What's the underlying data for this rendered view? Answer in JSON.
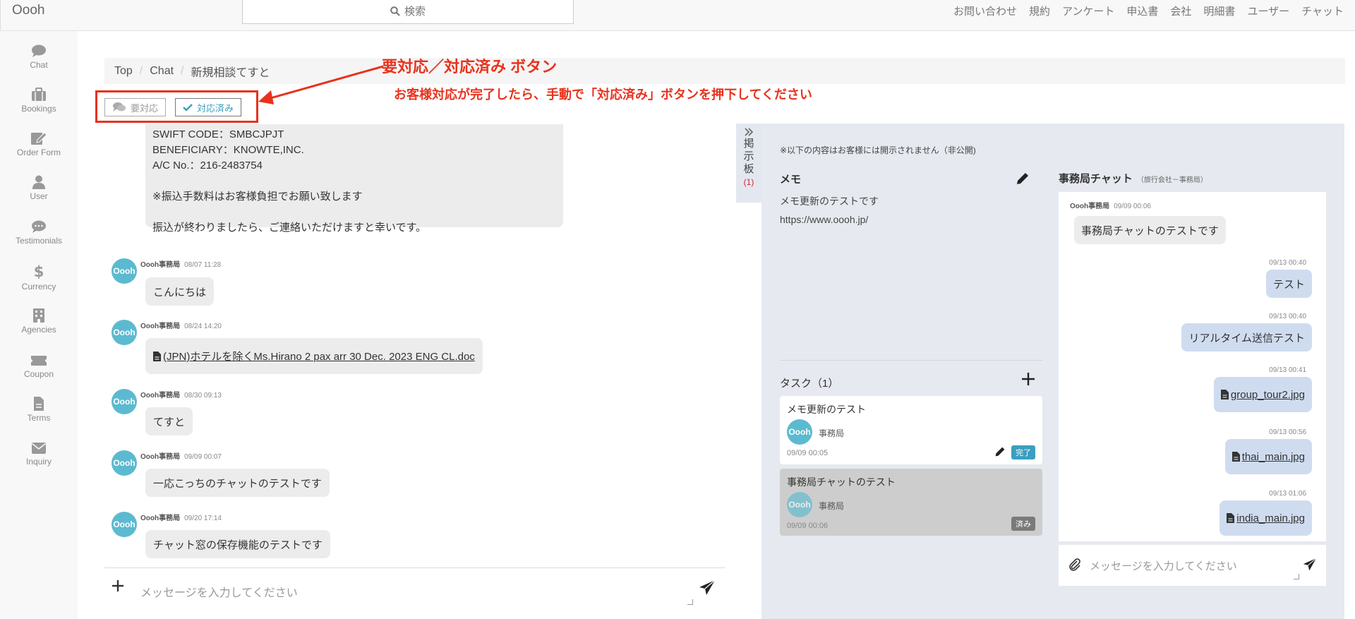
{
  "app": {
    "brand": "Oooh"
  },
  "search": {
    "label": "検索"
  },
  "nav": [
    "お問い合わせ",
    "規約",
    "アンケート",
    "申込書",
    "会社",
    "明細書",
    "ユーザー",
    "チャット"
  ],
  "sidebar": [
    {
      "label": "Chat",
      "icon": "chat-icon"
    },
    {
      "label": "Bookings",
      "icon": "briefcase-icon"
    },
    {
      "label": "Order Form",
      "icon": "order-form-icon"
    },
    {
      "label": "User",
      "icon": "user-icon"
    },
    {
      "label": "Testimonials",
      "icon": "testimonials-icon"
    },
    {
      "label": "Currency",
      "icon": "dollar-icon"
    },
    {
      "label": "Agencies",
      "icon": "building-icon"
    },
    {
      "label": "Coupon",
      "icon": "coupon-icon"
    },
    {
      "label": "Terms",
      "icon": "document-icon"
    },
    {
      "label": "Inquiry",
      "icon": "envelope-icon"
    }
  ],
  "breadcrumb": [
    "Top",
    "Chat",
    "新規相談てすと"
  ],
  "annotation": {
    "title": "要対応／対応済み ボタン",
    "description": "お客様対応が完了したら、手動で「対応済み」ボタンを押下してください"
  },
  "status_buttons": {
    "need": "要対応",
    "done": "対応済み"
  },
  "chat": {
    "top_message": [
      "SWIFT CODE：SMBCJPJT",
      "BENEFICIARY：KNOWTE,INC.",
      "A/C No.：216-2483754",
      "",
      "※振込手数料はお客様負担でお願い致します",
      "",
      "振込が終わりましたら、ご連絡いただけますと幸いです。"
    ],
    "avatar_label": "Oooh",
    "messages": [
      {
        "sender": "Oooh事務局",
        "time": "08/07 11:28",
        "text": "こんにちは",
        "file": false
      },
      {
        "sender": "Oooh事務局",
        "time": "08/24 14:20",
        "text": "(JPN)ホテルを除くMs.Hirano 2 pax arr 30 Dec. 2023 ENG CL.doc",
        "file": true
      },
      {
        "sender": "Oooh事務局",
        "time": "08/30 09:13",
        "text": "てすと",
        "file": false
      },
      {
        "sender": "Oooh事務局",
        "time": "09/09 00:07",
        "text": "一応こっちのチャットのテストです",
        "file": false
      },
      {
        "sender": "Oooh事務局",
        "time": "09/20 17:14",
        "text": "チャット窓の保存機能のテストです",
        "file": false
      }
    ],
    "input_placeholder": "メッセージを入力してください"
  },
  "board": {
    "label_chars": [
      "掲",
      "示",
      "板"
    ],
    "count": "(1)"
  },
  "panel": {
    "notice": "※以下の内容はお客様には開示されません（非公開)",
    "memo_title": "メモ",
    "memo_lines": [
      "メモ更新のテストです",
      "https://www.oooh.jp/"
    ],
    "task_title": "タスク（1）",
    "tasks": [
      {
        "title": "メモ更新のテスト",
        "assignee": "事務局",
        "date": "09/09 00:05",
        "badge": "完了",
        "done": false
      },
      {
        "title": "事務局チャットのテスト",
        "assignee": "事務局",
        "date": "09/09 00:06",
        "badge": "済み",
        "done": true
      }
    ],
    "office_chat": {
      "title": "事務局チャット",
      "subtitle": "（旅行会社－事務局）",
      "first": {
        "sender": "Oooh事務局",
        "time": "09/09 00:06",
        "text": "事務局チャットのテストです"
      },
      "messages": [
        {
          "time": "09/13 00:40",
          "text": "テスト",
          "file": false
        },
        {
          "time": "09/13 00:40",
          "text": "リアルタイム送信テスト",
          "file": false
        },
        {
          "time": "09/13 00:41",
          "text": "group_tour2.jpg",
          "file": true
        },
        {
          "time": "09/13 00:56",
          "text": "thai_main.jpg",
          "file": true
        },
        {
          "time": "09/13 01:06",
          "text": "india_main.jpg",
          "file": true
        }
      ],
      "input_placeholder": "メッセージを入力してください"
    }
  },
  "colors": {
    "accent": "#5cbad0",
    "annotation": "#e8321d",
    "done_badge": "#3a9fc0",
    "closed_badge": "#7a7a7a"
  }
}
